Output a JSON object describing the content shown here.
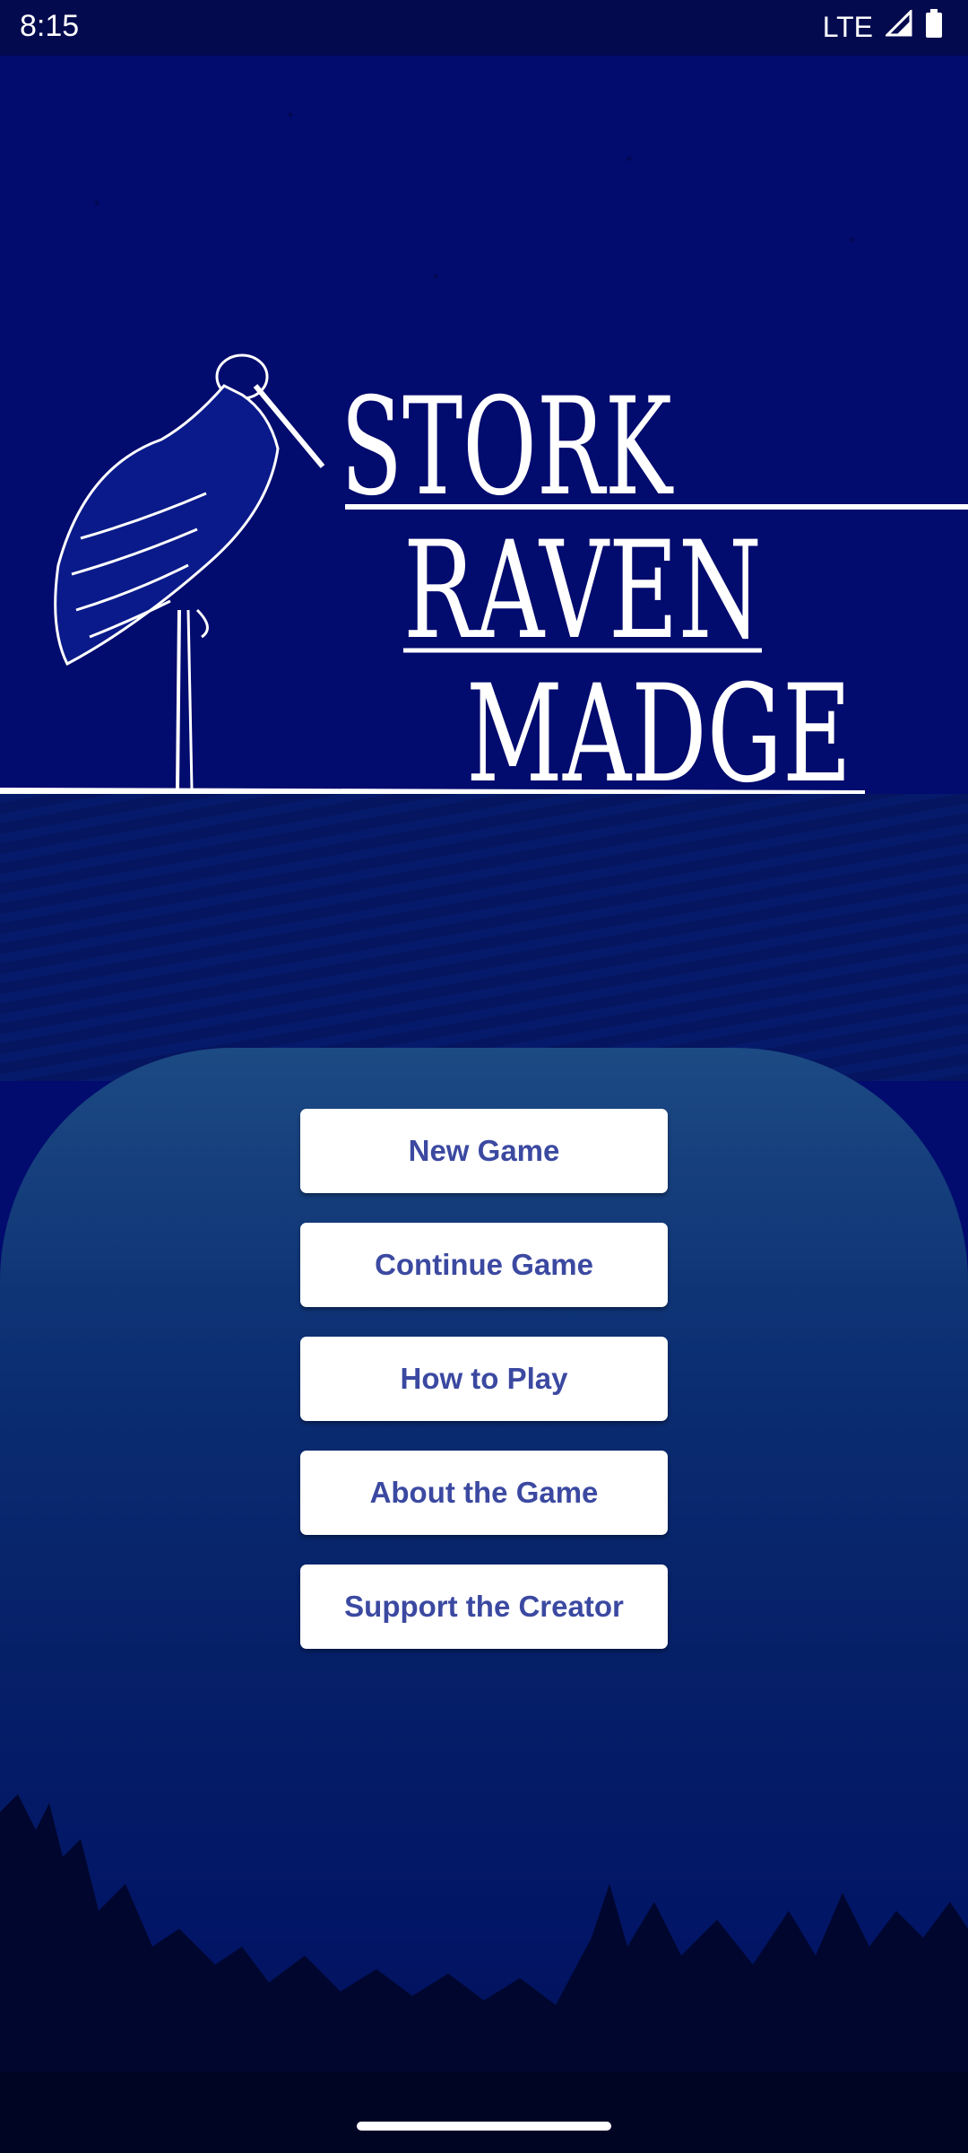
{
  "status_bar": {
    "time": "8:15",
    "network": "LTE",
    "icons": [
      "signal-icon",
      "battery-icon"
    ]
  },
  "title": {
    "line1": "STORK",
    "line2": "RAVEN",
    "line3": "MADGE"
  },
  "menu": {
    "new_game": "New Game",
    "continue_game": "Continue Game",
    "how_to_play": "How to Play",
    "about": "About the Game",
    "support": "Support the Creator"
  },
  "colors": {
    "background": "#020b6e",
    "button_text": "#3b49a1",
    "button_bg": "#ffffff"
  }
}
